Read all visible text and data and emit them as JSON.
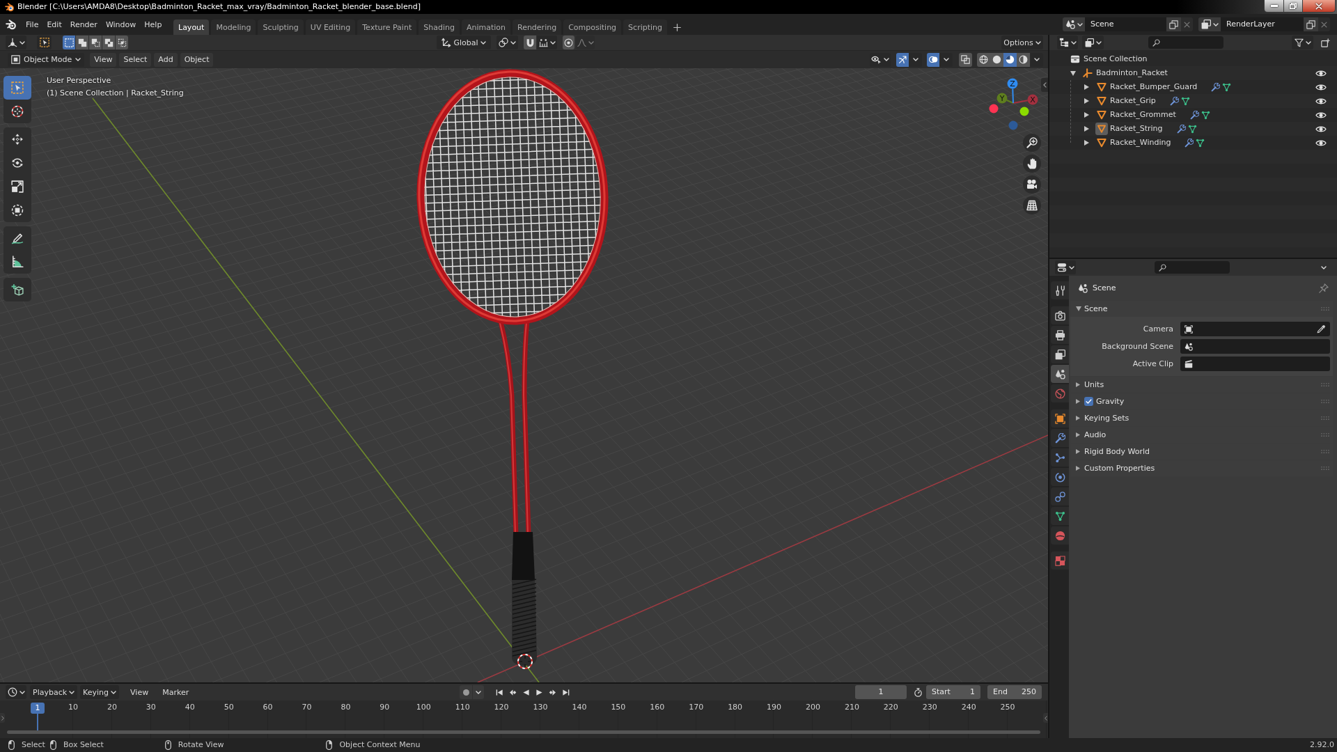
{
  "window": {
    "title": "Blender [C:\\Users\\AMDA8\\Desktop\\Badminton_Racket_max_vray/Badminton_Racket_blender_base.blend]"
  },
  "menu": [
    "File",
    "Edit",
    "Render",
    "Window",
    "Help"
  ],
  "workspaces": [
    {
      "label": "Layout",
      "selected": true
    },
    {
      "label": "Modeling",
      "selected": false
    },
    {
      "label": "Sculpting",
      "selected": false
    },
    {
      "label": "UV Editing",
      "selected": false
    },
    {
      "label": "Texture Paint",
      "selected": false
    },
    {
      "label": "Shading",
      "selected": false
    },
    {
      "label": "Animation",
      "selected": false
    },
    {
      "label": "Rendering",
      "selected": false
    },
    {
      "label": "Compositing",
      "selected": false
    },
    {
      "label": "Scripting",
      "selected": false
    }
  ],
  "scene": {
    "value": "Scene"
  },
  "view_layer": {
    "value": "RenderLayer"
  },
  "tool_header": {
    "select_modes": [
      {
        "selected": true
      },
      {
        "selected": false
      },
      {
        "selected": false
      },
      {
        "selected": false
      },
      {
        "selected": false
      }
    ],
    "orientation": "Global",
    "toggles": [
      {
        "on": false
      },
      {
        "on": false
      }
    ],
    "options": "Options"
  },
  "viewport": {
    "mode": "Object Mode",
    "menus": [
      "View",
      "Select",
      "Add",
      "Object"
    ],
    "toggles": [
      {
        "on": true
      },
      {
        "on": true
      },
      {
        "on": false
      }
    ],
    "shading": [
      {
        "selected": false
      },
      {
        "selected": false
      },
      {
        "selected": true
      },
      {
        "selected": false
      }
    ],
    "view_name": "User Perspective",
    "context": "(1) Scene Collection | Racket_String",
    "tools": [
      {
        "selected": true
      },
      {
        "selected": false
      },
      {
        "selected": false
      },
      {
        "selected": false
      },
      {
        "selected": false
      },
      {
        "selected": false
      },
      {
        "selected": false
      },
      {
        "selected": false
      },
      {
        "selected": false
      }
    ],
    "gizmo": {
      "axes": [
        {
          "kind": "positive",
          "label": "X",
          "color": "#a3303f"
        },
        {
          "kind": "positive",
          "label": "Y",
          "color": "#5e7e1e"
        },
        {
          "kind": "positive",
          "label": "Z",
          "color": "#2f8cf2"
        },
        {
          "kind": "negative",
          "color": "#ff3352"
        },
        {
          "kind": "negative",
          "color": "#8bdc00"
        },
        {
          "kind": "negative",
          "color": "#2c5a98"
        }
      ]
    }
  },
  "outliner": {
    "root": "Scene Collection",
    "items": [
      {
        "label": "Badminton_Racket",
        "kind": "empty",
        "expanded": true,
        "selected": false,
        "visible": true,
        "children": [
          {
            "label": "Racket_Bumper_Guard",
            "kind": "mesh",
            "expanded": false,
            "selected": false,
            "visible": true
          },
          {
            "label": "Racket_Grip",
            "kind": "mesh",
            "expanded": false,
            "selected": false,
            "visible": true
          },
          {
            "label": "Racket_Grommet",
            "kind": "mesh",
            "expanded": false,
            "selected": false,
            "visible": true
          },
          {
            "label": "Racket_String",
            "kind": "mesh",
            "expanded": false,
            "selected": true,
            "visible": true
          },
          {
            "label": "Racket_Winding",
            "kind": "mesh",
            "expanded": false,
            "selected": false,
            "visible": true
          }
        ]
      }
    ]
  },
  "properties": {
    "tabs": [
      {
        "selected": false
      },
      {
        "selected": false
      },
      {
        "selected": false
      },
      {
        "selected": false
      },
      {
        "selected": true
      },
      {
        "selected": false
      },
      {
        "selected": false
      },
      {
        "selected": false
      },
      {
        "selected": false
      },
      {
        "selected": false
      },
      {
        "selected": false
      },
      {
        "selected": false
      },
      {
        "selected": false
      },
      {
        "selected": false
      }
    ],
    "context": "Scene",
    "panels": [
      {
        "kind": "panel",
        "label": "Scene",
        "expanded": true,
        "fields": [
          {
            "label": "Camera"
          },
          {
            "label": "Background Scene"
          },
          {
            "label": "Active Clip"
          }
        ]
      },
      {
        "kind": "panel",
        "label": "Units",
        "expanded": false
      },
      {
        "kind": "checkbox",
        "label": "Gravity",
        "expanded": false,
        "checked": true
      },
      {
        "kind": "panel",
        "label": "Keying Sets",
        "expanded": false
      },
      {
        "kind": "panel",
        "label": "Audio",
        "expanded": false
      },
      {
        "kind": "panel",
        "label": "Rigid Body World",
        "expanded": false
      },
      {
        "kind": "panel",
        "label": "Custom Properties",
        "expanded": false
      }
    ]
  },
  "timeline": {
    "menus": [
      {
        "label": "Playback",
        "kind": "popover"
      },
      {
        "label": "Keying",
        "kind": "popover"
      },
      {
        "label": "View",
        "kind": "menu"
      },
      {
        "label": "Marker",
        "kind": "menu"
      }
    ],
    "auto_keying": {
      "on": false
    },
    "current_frame": "1",
    "start": {
      "label": "Start",
      "value": "1"
    },
    "end": {
      "label": "End",
      "value": "250"
    },
    "playhead": "1",
    "ticks": [
      "10",
      "20",
      "30",
      "40",
      "50",
      "60",
      "70",
      "80",
      "90",
      "100",
      "110",
      "120",
      "130",
      "140",
      "150",
      "160",
      "170",
      "180",
      "190",
      "200",
      "210",
      "220",
      "230",
      "240",
      "250"
    ]
  },
  "status_bar": {
    "hints": [
      "Select",
      "Box Select",
      "Rotate View",
      "Object Context Menu"
    ],
    "version": "2.92.0"
  }
}
